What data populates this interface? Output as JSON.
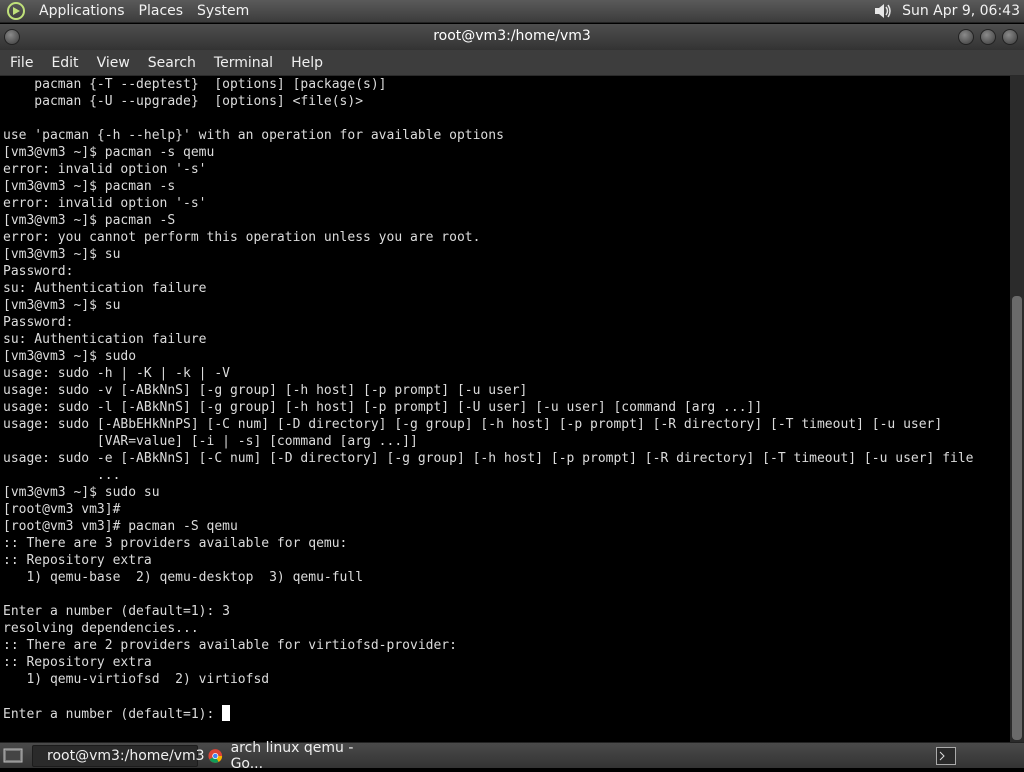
{
  "top_panel": {
    "menus": [
      "Applications",
      "Places",
      "System"
    ],
    "clock": "Sun Apr  9, 06:43"
  },
  "window": {
    "title": "root@vm3:/home/vm3"
  },
  "menubar": {
    "items": [
      "File",
      "Edit",
      "View",
      "Search",
      "Terminal",
      "Help"
    ]
  },
  "terminal": {
    "lines": [
      "    pacman {-T --deptest}  [options] [package(s)]",
      "    pacman {-U --upgrade}  [options] <file(s)>",
      "",
      "use 'pacman {-h --help}' with an operation for available options",
      "[vm3@vm3 ~]$ pacman -s qemu",
      "error: invalid option '-s'",
      "[vm3@vm3 ~]$ pacman -s",
      "error: invalid option '-s'",
      "[vm3@vm3 ~]$ pacman -S",
      "error: you cannot perform this operation unless you are root.",
      "[vm3@vm3 ~]$ su",
      "Password:",
      "su: Authentication failure",
      "[vm3@vm3 ~]$ su",
      "Password:",
      "su: Authentication failure",
      "[vm3@vm3 ~]$ sudo",
      "usage: sudo -h | -K | -k | -V",
      "usage: sudo -v [-ABkNnS] [-g group] [-h host] [-p prompt] [-u user]",
      "usage: sudo -l [-ABkNnS] [-g group] [-h host] [-p prompt] [-U user] [-u user] [command [arg ...]]",
      "usage: sudo [-ABbEHkNnPS] [-C num] [-D directory] [-g group] [-h host] [-p prompt] [-R directory] [-T timeout] [-u user]",
      "            [VAR=value] [-i | -s] [command [arg ...]]",
      "usage: sudo -e [-ABkNnS] [-C num] [-D directory] [-g group] [-h host] [-p prompt] [-R directory] [-T timeout] [-u user] file",
      "            ...",
      "[vm3@vm3 ~]$ sudo su",
      "[root@vm3 vm3]#",
      "[root@vm3 vm3]# pacman -S qemu",
      ":: There are 3 providers available for qemu:",
      ":: Repository extra",
      "   1) qemu-base  2) qemu-desktop  3) qemu-full",
      "",
      "Enter a number (default=1): 3",
      "resolving dependencies...",
      ":: There are 2 providers available for virtiofsd-provider:",
      ":: Repository extra",
      "   1) qemu-virtiofsd  2) virtiofsd",
      "",
      "Enter a number (default=1): "
    ]
  },
  "taskbar": {
    "tasks": [
      {
        "label": "root@vm3:/home/vm3",
        "icon": "terminal-icon"
      },
      {
        "label": "arch linux qemu - Go...",
        "icon": "chrome-icon"
      }
    ]
  },
  "colors": {
    "panel": "#4a4a4a",
    "terminal_bg": "#000000",
    "terminal_fg": "#dcdcdc"
  }
}
